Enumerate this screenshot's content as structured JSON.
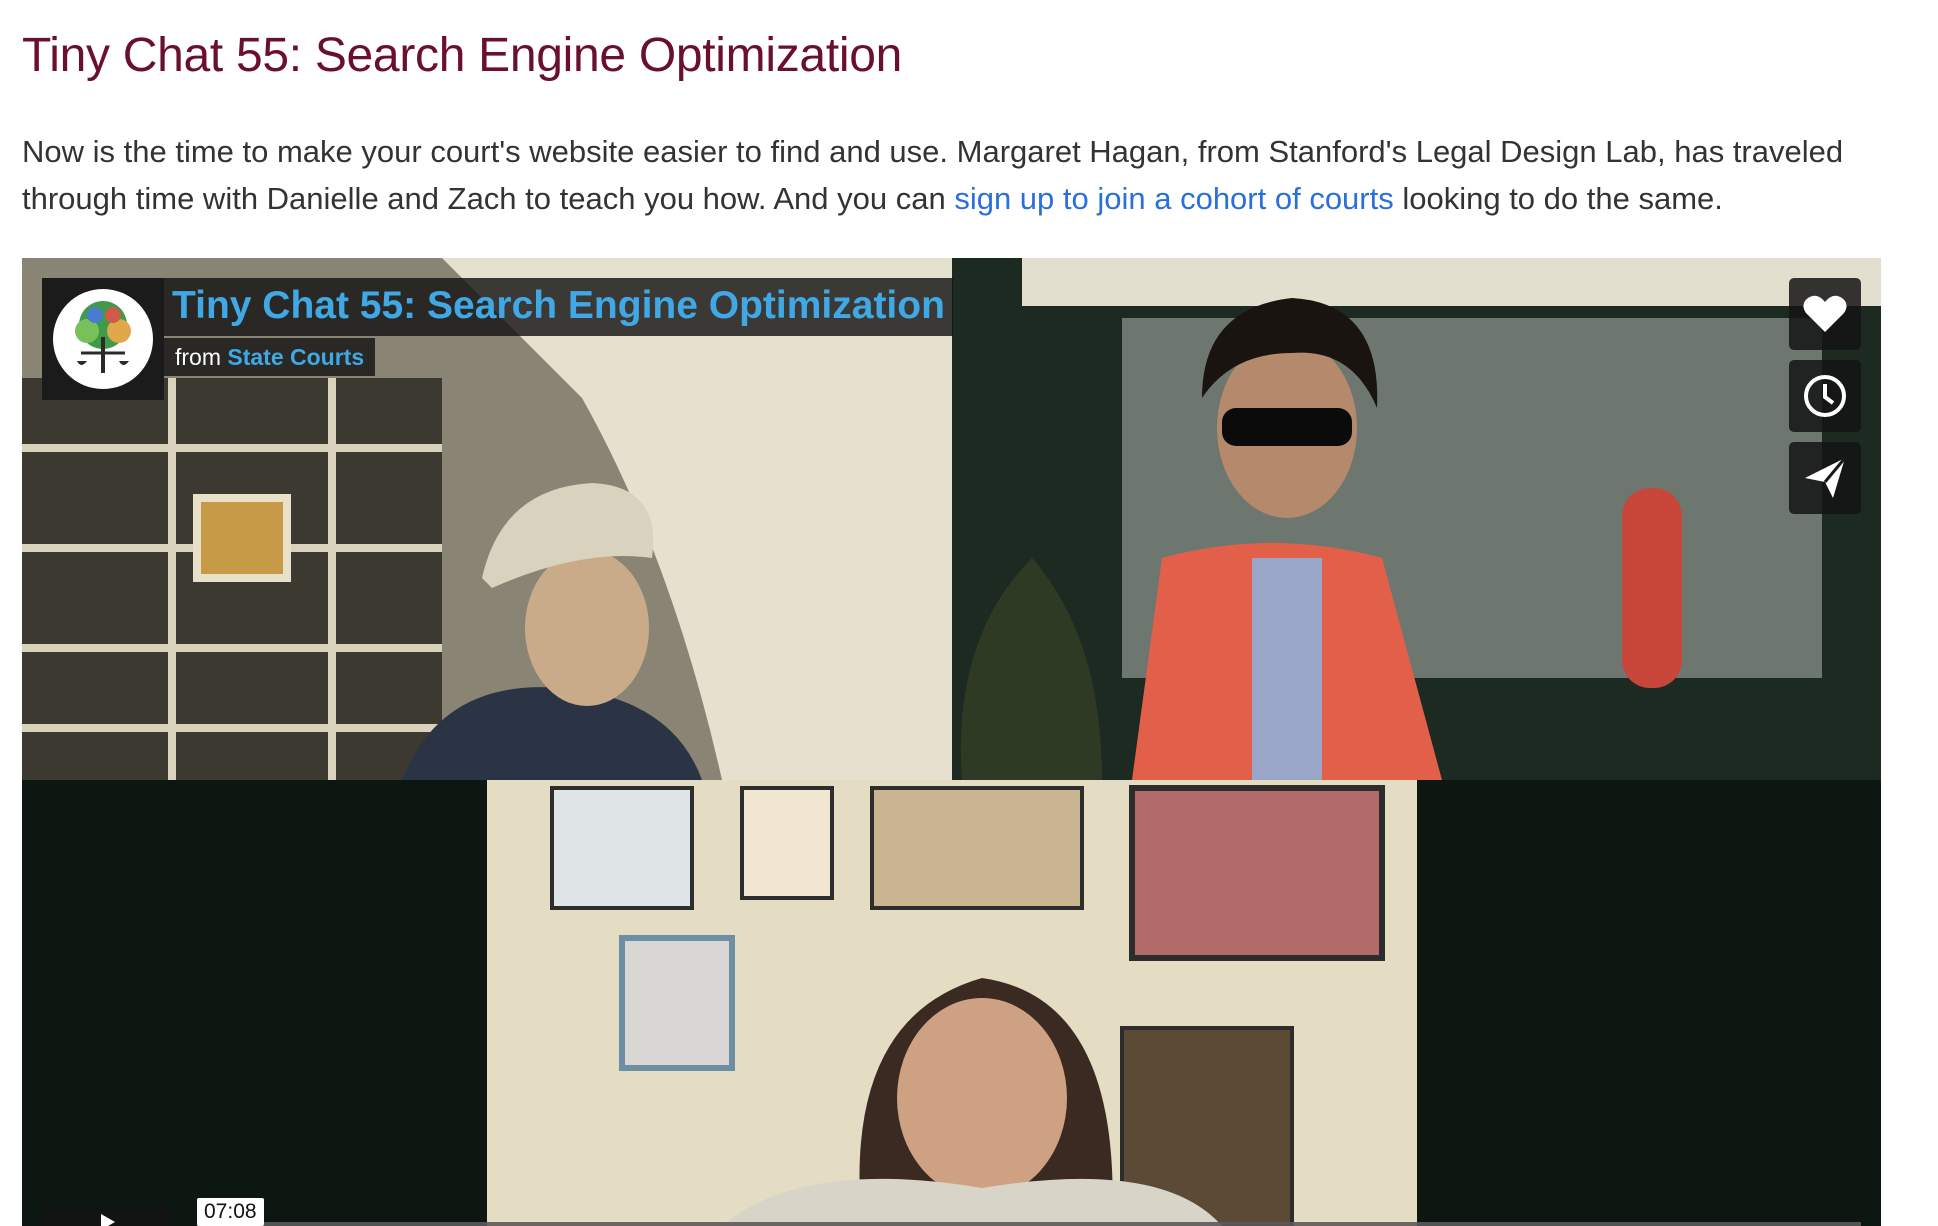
{
  "page": {
    "title": "Tiny Chat 55: Search Engine Optimization",
    "intro": {
      "text_before": "Now is the time to make your court's website easier to find and use. Margaret Hagan, from Stanford's Legal Design Lab, has traveled through time with Danielle and Zach to teach you how. And you can ",
      "link_text": "sign up to join a cohort of courts",
      "text_after": " looking to do the same."
    }
  },
  "player": {
    "video_title": "Tiny Chat 55: Search Engine Optimization",
    "byline_prefix": "from",
    "channel_name": "State Courts",
    "logo_icon": "tree-scales-logo",
    "side_buttons": [
      {
        "name": "like-button",
        "icon": "heart-icon"
      },
      {
        "name": "watch-later-button",
        "icon": "clock-icon"
      },
      {
        "name": "share-button",
        "icon": "paper-plane-icon"
      }
    ],
    "time_badge": "07:08",
    "progress": 0
  },
  "colors": {
    "title": "#6b0f2e",
    "link": "#2a6fdb",
    "player_accent": "#41a8e6",
    "player_bg": "#0c1712"
  }
}
